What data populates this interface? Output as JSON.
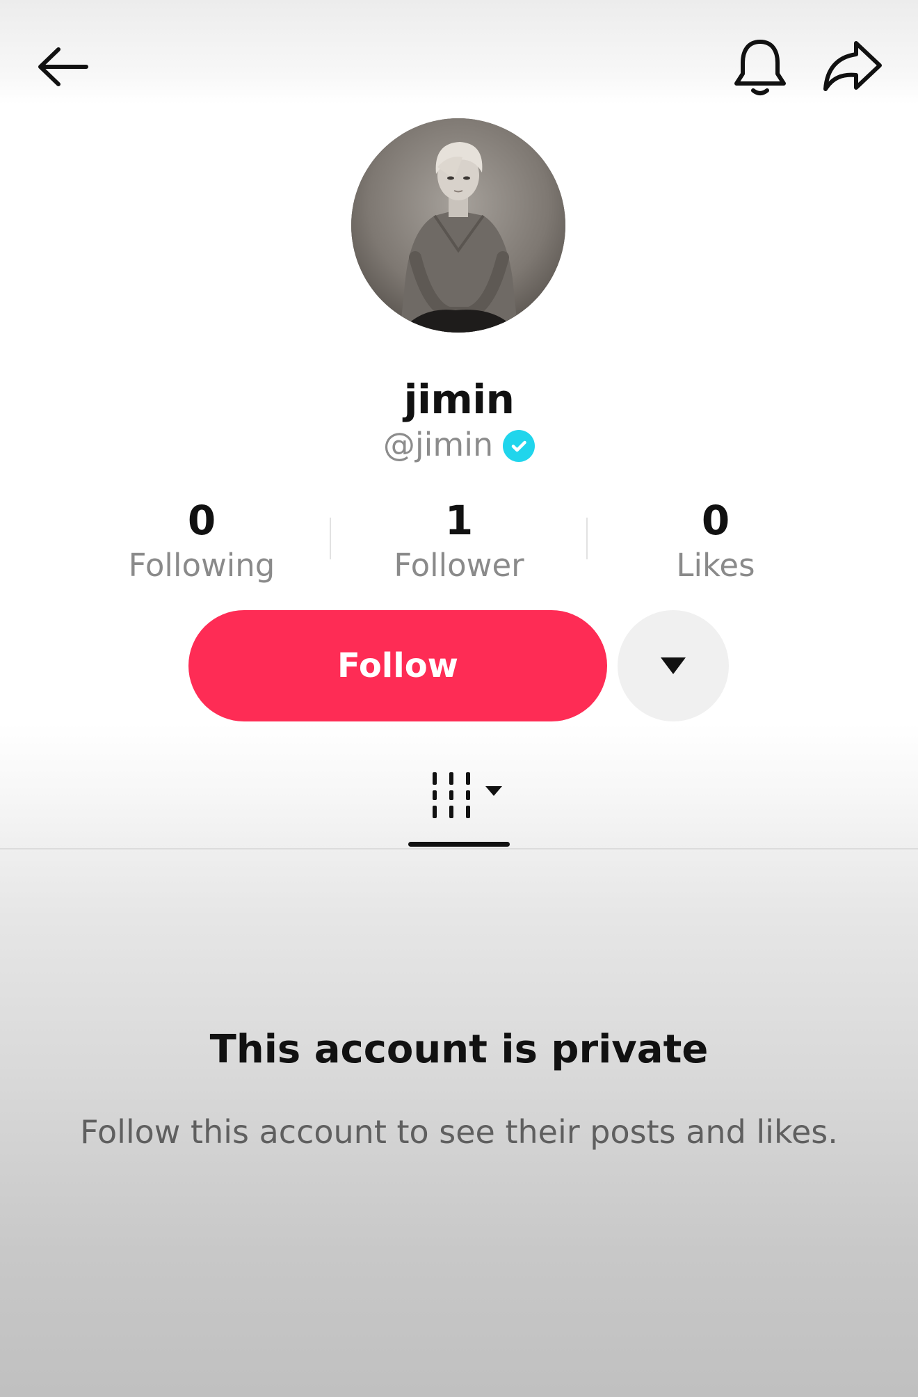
{
  "header": {
    "back_icon": "arrow-left-icon",
    "notification_icon": "bell-icon",
    "share_icon": "share-arrow-icon"
  },
  "profile": {
    "avatar": "profile-photo",
    "display_name": "jimin",
    "username": "@jimin",
    "verified": true,
    "verified_color": "#20d5ec"
  },
  "stats": [
    {
      "value": "0",
      "label": "Following"
    },
    {
      "value": "1",
      "label": "Follower"
    },
    {
      "value": "0",
      "label": "Likes"
    }
  ],
  "actions": {
    "follow_label": "Follow",
    "follow_color": "#fe2c55",
    "more_icon": "caret-down-icon"
  },
  "tabs": {
    "active_icon": "videos-grid-icon"
  },
  "private_notice": {
    "title": "This account is private",
    "message": "Follow this account to see their posts and likes."
  }
}
